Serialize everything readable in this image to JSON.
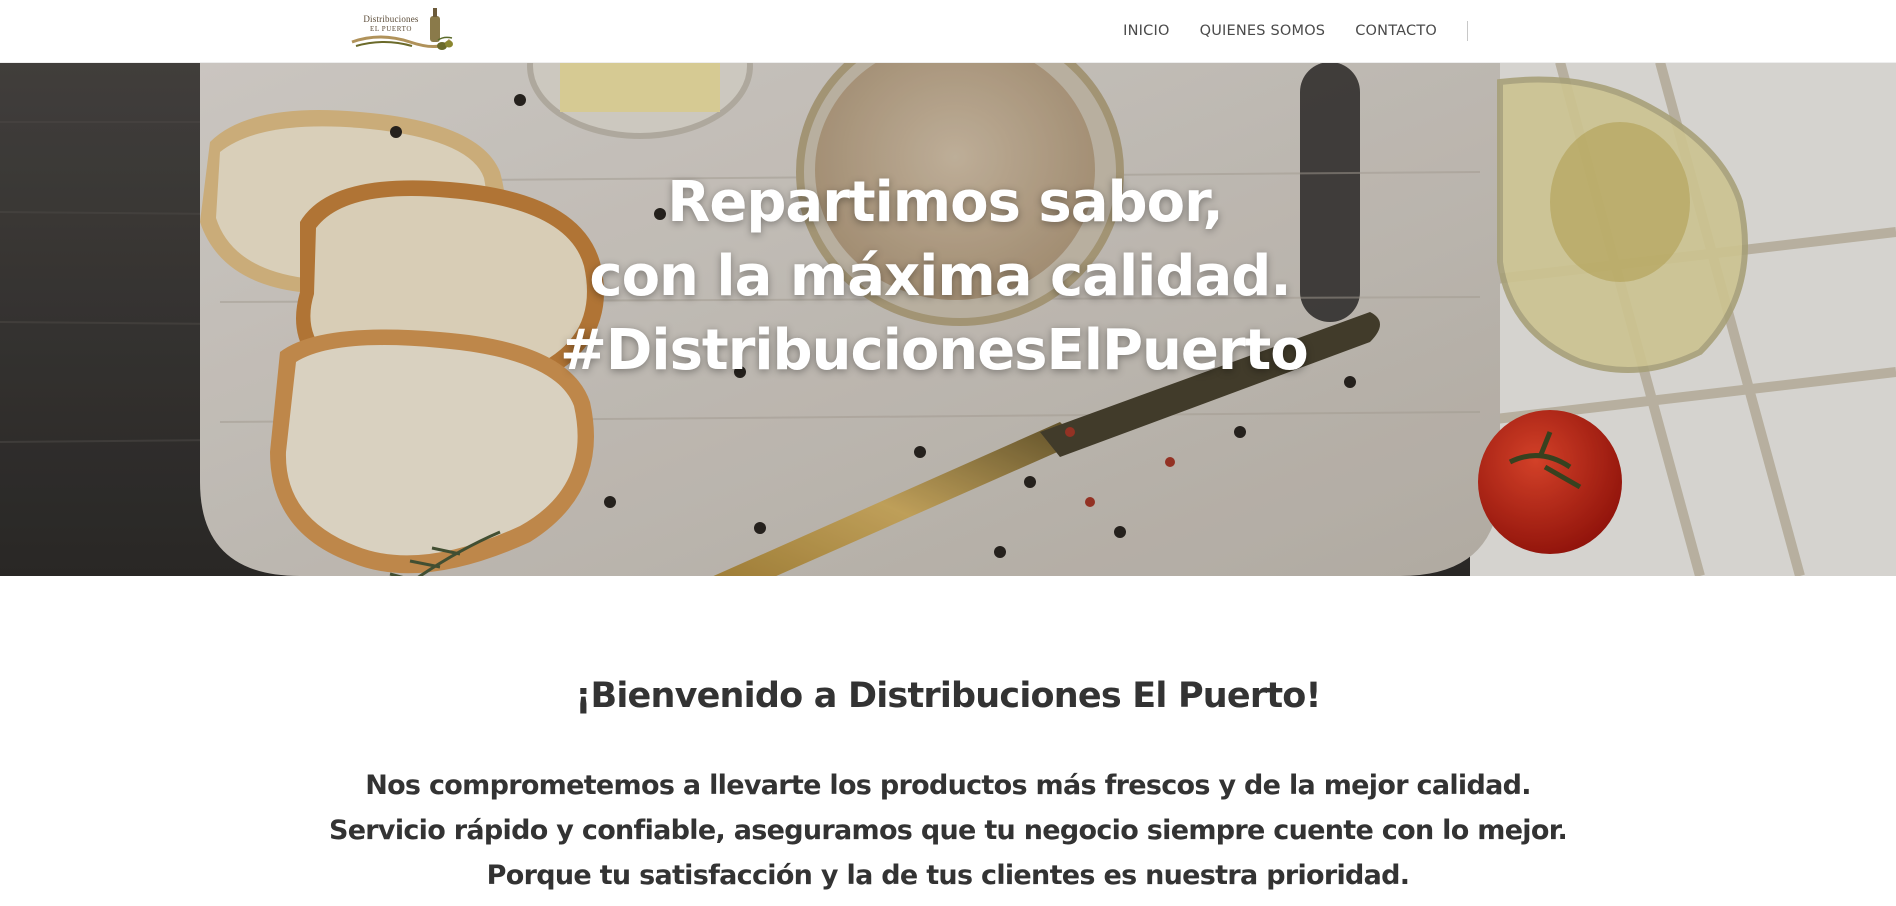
{
  "brand": {
    "logo_line1": "Distribuciones",
    "logo_line2": "EL PUERTO",
    "colors": {
      "gold": "#b0925a",
      "olive": "#6b6a2a",
      "text": "#5a4a36"
    }
  },
  "nav": {
    "items": [
      {
        "label": "INICIO"
      },
      {
        "label": "QUIENES SOMOS"
      },
      {
        "label": "CONTACTO"
      }
    ]
  },
  "hero": {
    "title_line1": "Repartimos sabor,",
    "title_line2": "con la máxima calidad.",
    "title_line3": "#DistribucionesElPuerto"
  },
  "welcome": {
    "heading": "¡Bienvenido a Distribuciones El Puerto!",
    "line1": "Nos comprometemos a llevarte los productos más frescos y de la mejor calidad.",
    "line2": "Servicio rápido y confiable, aseguramos que tu negocio siempre cuente con lo mejor.",
    "line3": "Porque tu satisfacción y la de tus clientes es nuestra prioridad."
  }
}
